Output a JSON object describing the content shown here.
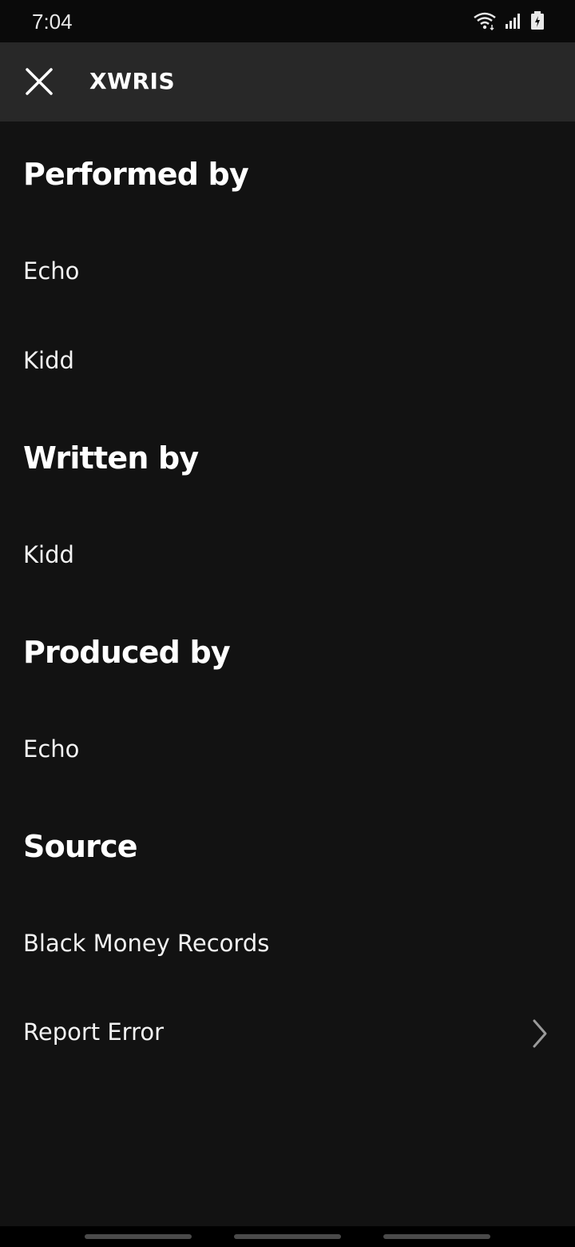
{
  "status_bar": {
    "time": "7:04",
    "icons": [
      "wifi-icon",
      "signal-icon",
      "battery-icon"
    ]
  },
  "header": {
    "title": "XWRIS",
    "close_icon": "close-icon"
  },
  "sections": {
    "performed": {
      "heading": "Performed by",
      "items": [
        "Echo",
        "Kidd"
      ]
    },
    "written": {
      "heading": "Written by",
      "items": [
        "Kidd"
      ]
    },
    "produced": {
      "heading": "Produced by",
      "items": [
        "Echo"
      ]
    },
    "source": {
      "heading": "Source",
      "items": [
        "Black Money Records"
      ]
    }
  },
  "report": {
    "label": "Report Error",
    "icon": "chevron-right-icon"
  },
  "colors": {
    "background": "#121212",
    "header": "#282828",
    "text": "#ffffff",
    "chevron": "#9a9a9a"
  }
}
